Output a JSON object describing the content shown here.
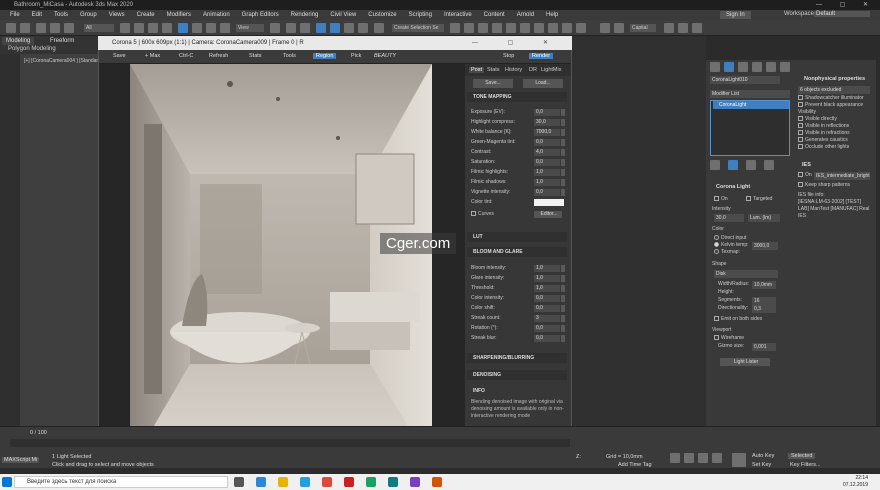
{
  "app_title": "Bathroom_MiCasa - Autodesk 3ds Max 2020",
  "menu": [
    "File",
    "Edit",
    "Tools",
    "Group",
    "Views",
    "Create",
    "Modifiers",
    "Animation",
    "Graph Editors",
    "Rendering",
    "Civil View",
    "Customize",
    "Scripting",
    "Interactive",
    "Content",
    "Arnold",
    "Help"
  ],
  "sign_in": "Sign In",
  "workspaces_label": "Workspaces:",
  "workspaces_value": "Default",
  "toolbar": {
    "filter": "All",
    "view": "View",
    "selset": "Create Selection Se",
    "capital": "Capital"
  },
  "ribbon": {
    "tab1": "Modeling",
    "tab2": "Freeform",
    "sub": "Polygon Modeling"
  },
  "viewport_label": "[+] [CoronaCamera004 ] [Standard ] [Default Shading]",
  "render_window": {
    "title": "Corona 5 | 600x 609px (1:1) | Camera: CoronaCamera009 | Frame 0 | R",
    "toolbar": [
      "Save",
      "+ Max",
      "Ctrl-C",
      "Refresh",
      "Stats",
      "Tools",
      "Region",
      "Pick",
      "BEAUTY"
    ],
    "right_toolbar": [
      "Stop",
      "Render"
    ],
    "tabs": [
      "Post",
      "Stats",
      "History",
      "DR",
      "LightMix"
    ],
    "buttons": [
      "Save...",
      "Load..."
    ],
    "sections": {
      "tone": "TONE MAPPING",
      "lut": "LUT",
      "bloom": "BLOOM AND GLARE",
      "sharpen": "SHARPENING/BLURRING",
      "denoise": "DENOISING",
      "info": "INFO"
    },
    "tone_rows": [
      {
        "label": "Exposure (EV):",
        "value": "0,0"
      },
      {
        "label": "Highlight compress:",
        "value": "30,0"
      },
      {
        "label": "White balance [K]:",
        "value": "7000,0"
      },
      {
        "label": "Green-Magenta tint:",
        "value": "0,0"
      },
      {
        "label": "Contrast:",
        "value": "4,0"
      },
      {
        "label": "Saturation:",
        "value": "0,0"
      },
      {
        "label": "Filmic highlights:",
        "value": "1,0"
      },
      {
        "label": "Filmic shadows:",
        "value": "1,0"
      },
      {
        "label": "Vignette intensity:",
        "value": "0,0"
      },
      {
        "label": "Color tint:",
        "value": ""
      }
    ],
    "curves_label": "Curves",
    "curves_btn": "Editor...",
    "bloom_rows": [
      {
        "label": "Bloom intensity:",
        "value": "1,0"
      },
      {
        "label": "Glare intensity:",
        "value": "1,0"
      },
      {
        "label": "Threshold:",
        "value": "1,0"
      },
      {
        "label": "Color intensity:",
        "value": "0,0"
      },
      {
        "label": "Color shift:",
        "value": "0,0"
      },
      {
        "label": "Streak count:",
        "value": "3"
      },
      {
        "label": "Rotation (°):",
        "value": "0,0"
      },
      {
        "label": "Streak blur:",
        "value": "0,0"
      }
    ],
    "info_text": "Blending denoised image with original via denoising amount is available only in non-interactive rendering mode"
  },
  "command_panel": {
    "object_name": "CoronaLight010",
    "modifier_list": "Modifier List",
    "stack_item": "CoronaLight",
    "np_title": "Nonphysical properties",
    "np_items": [
      "6 objects excluded",
      "Shadowcatcher illuminator",
      "Prevent black appearance",
      "Visibility",
      "Visible directly",
      "Visible in reflections",
      "Visible in refractions",
      "Generates caustics",
      "Occlude other lights"
    ],
    "ies_title": "IES",
    "ies_on": "On",
    "ies_file": "IES_intermediate_bright",
    "ies_keep": "Keep sharp patterns",
    "ies_info_label": "IES file info:",
    "ies_info": "[IESNA:LM-63-2002] [TEST] LAB] ManTest [MANUFAC] Real IES",
    "cl_title": "Corona Light",
    "on": "On",
    "targeted": "Targeted",
    "intensity_label": "Intensity",
    "intensity_value": "30,0",
    "intensity_unit": "Lum. (lm)",
    "color_label": "Color",
    "direct_input": "Direct input",
    "kelvin": "Kelvin temp:",
    "kelvin_value": "3000,0",
    "texmap": "Texmap:",
    "shape_label": "Shape",
    "shape_value": "Disk",
    "width_label": "Width/Radius:",
    "width_value": "10,0mm",
    "height_label": "Height:",
    "segments_label": "Segments:",
    "segments_value": "16",
    "directionality_label": "Directionality:",
    "directionality_value": "0,3",
    "emit": "Emit on both sides",
    "viewport_label": "Viewport",
    "wireframe": "Wireframe",
    "gizmo_label": "Gizmo size:",
    "gizmo_value": "0,001",
    "lightlister": "Light Lister"
  },
  "watermark": "Cger.com",
  "bottom": {
    "frame_counter": "0 / 100",
    "status1": "1 Light Selected",
    "status2": "Click and drag to select and move objects",
    "grid": "Grid = 10,0mm",
    "add_time_tag": "Add Time Tag",
    "auto_key": "Auto Key",
    "set_key": "Set Key",
    "selected": "Selected",
    "key_filters": "Key Filters...",
    "z_label": "Z:",
    "maxscript": "MAXScript Mi"
  },
  "taskbar": {
    "search": "Введите здесь текст для поиска",
    "time": "22:14",
    "date": "07.12.2019"
  }
}
